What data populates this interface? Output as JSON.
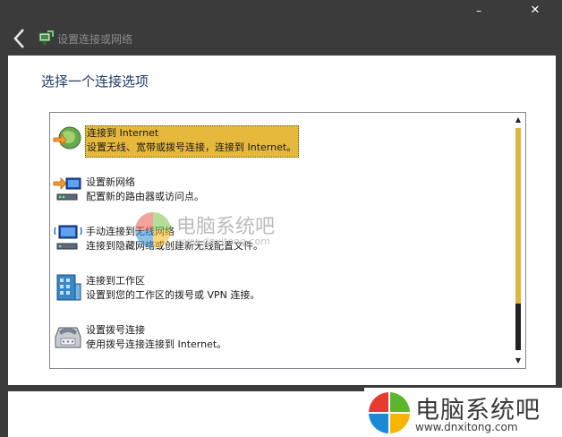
{
  "window": {
    "minimize_glyph": "–",
    "close_glyph": "✕",
    "title": "设置连接或网络"
  },
  "heading": "选择一个连接选项",
  "options": [
    {
      "title": "连接到 Internet",
      "desc": "设置无线、宽带或拨号连接，连接到 Internet。",
      "icon": "globe-internet-icon",
      "selected": true
    },
    {
      "title": "设置新网络",
      "desc": "配置新的路由器或访问点。",
      "icon": "new-network-icon",
      "selected": false
    },
    {
      "title": "手动连接到无线网络",
      "desc": "连接到隐藏网络或创建新无线配置文件。",
      "icon": "wireless-network-icon",
      "selected": false
    },
    {
      "title": "连接到工作区",
      "desc": "设置到您的工作区的拨号或 VPN 连接。",
      "icon": "workplace-icon",
      "selected": false
    },
    {
      "title": "设置拨号连接",
      "desc": "使用拨号连接连接到 Internet。",
      "icon": "dialup-modem-icon",
      "selected": false
    }
  ],
  "scroll": {
    "up": "▲",
    "down": "▼"
  },
  "watermark": {
    "name": "电脑系统吧",
    "url": "www.dnxitong.com"
  },
  "colors": {
    "selection": "#e6b93c",
    "heading": "#1f3a63",
    "titlebar": "#3b3b3b"
  }
}
